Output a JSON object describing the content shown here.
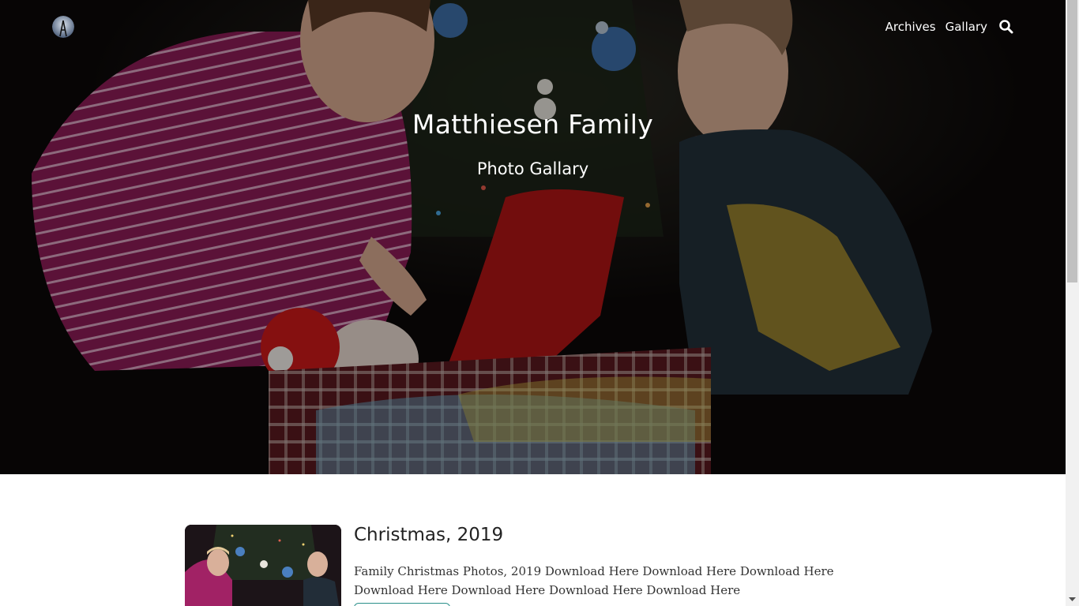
{
  "nav": {
    "links": [
      "Archives",
      "Gallary"
    ],
    "logo_icon": "logo-icon",
    "search_icon": "search-icon"
  },
  "hero": {
    "title": "Matthiesen Family",
    "subtitle": "Photo Gallary"
  },
  "post": {
    "title": "Christmas, 2019",
    "excerpt": "Family Christmas Photos, 2019 Download Here Download Here Download Here Download Here Download Here Download Here Download Here"
  },
  "colors": {
    "accent": "#2a8f8a",
    "hero_overlay": "#000000"
  }
}
